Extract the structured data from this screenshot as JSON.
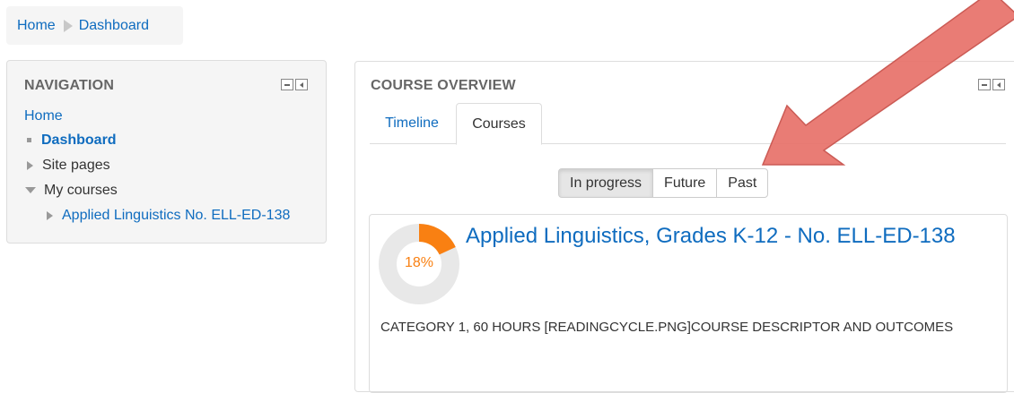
{
  "breadcrumb": {
    "home": "Home",
    "current": "Dashboard"
  },
  "navigation": {
    "title": "NAVIGATION",
    "home": "Home",
    "items": [
      {
        "label": "Dashboard"
      },
      {
        "label": "Site pages"
      },
      {
        "label": "My courses"
      },
      {
        "label": "Applied Linguistics No. ELL-ED-138"
      }
    ]
  },
  "course_overview": {
    "title": "COURSE OVERVIEW",
    "tabs": [
      {
        "label": "Timeline"
      },
      {
        "label": "Courses",
        "active": true
      }
    ],
    "filters": [
      {
        "label": "In progress",
        "active": true
      },
      {
        "label": "Future"
      },
      {
        "label": "Past"
      }
    ],
    "course": {
      "name": "Applied Linguistics, Grades K-12 - No. ELL-ED-138",
      "progress_label": "18%",
      "progress_fraction": 0.18,
      "summary": "Category 1, 60 hours [readingcycle.png]Course Descriptor and Outcomes"
    }
  },
  "colors": {
    "link": "#0f6cbf",
    "progress": "#f98012",
    "progress_track": "#e8e8e8",
    "arrow": "#e8756e"
  },
  "icons": {
    "block_minimize": "minus-box-icon",
    "block_dock": "dock-left-icon"
  }
}
